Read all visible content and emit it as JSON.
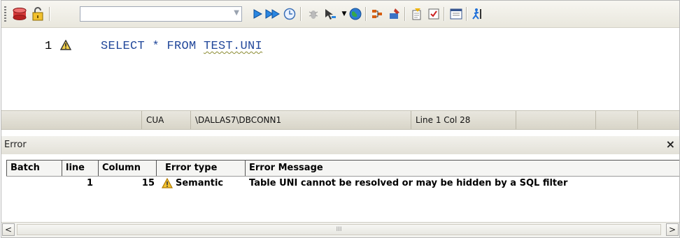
{
  "toolbar": {
    "connection_combo_value": "",
    "icons": [
      "database-icon",
      "lock-icon",
      "execute-icon",
      "execute-all-icon",
      "clock-icon",
      "debug-icon",
      "step-icon",
      "globe-icon",
      "explain-icon",
      "tool-icon",
      "edit-icon",
      "check-icon",
      "window-icon",
      "run-icon"
    ]
  },
  "editor": {
    "line_number": "1",
    "code_prefix": "SELECT * FROM ",
    "code_error_token": "TEST.UNI"
  },
  "status_bar": {
    "schema": "CUA",
    "connection": "\\DALLAS7\\DBCONN1",
    "position": "Line 1 Col 28"
  },
  "error_panel": {
    "title": "Error",
    "close": "×",
    "columns": [
      "Batch",
      "line",
      "Column",
      "Error type",
      "Error Message"
    ],
    "rows": [
      {
        "batch": "",
        "line": "1",
        "column": "15",
        "type": "Semantic",
        "message": "Table UNI  cannot be resolved or may be hidden by a SQL filter"
      }
    ]
  },
  "scrollbar": {
    "left": "<",
    "right": ">",
    "grip": "III"
  },
  "colors": {
    "code": "#21479a",
    "warning": "#e8b400",
    "accent": "#1e6fd9"
  }
}
